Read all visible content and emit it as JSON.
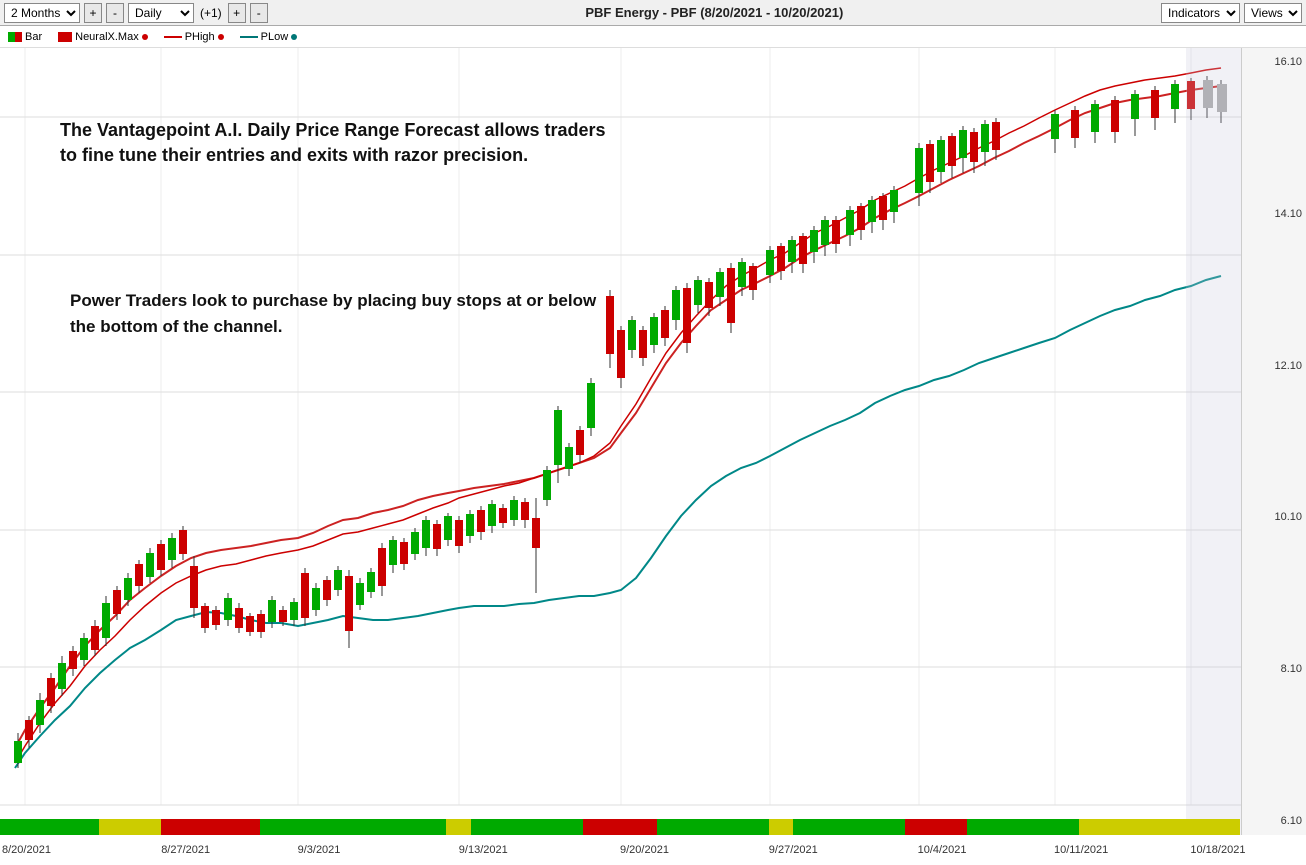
{
  "toolbar": {
    "period": "2 Months",
    "plus_label": "+",
    "minus_label": "-",
    "interval": "Daily",
    "offset_label": "(+1)",
    "plus2_label": "+",
    "minus2_label": "-",
    "title": "PBF Energy - PBF (8/20/2021 - 10/20/2021)",
    "indicators_label": "Indicators",
    "views_label": "Views"
  },
  "legend": {
    "bar_label": "Bar",
    "neural_label": "NeuralX.Max",
    "phigh_label": "PHigh",
    "plow_label": "PLow"
  },
  "annotations": {
    "text1": "The Vantagepoint A.I. Daily Price Range Forecast allows traders to fine tune their entries and exits with razor precision.",
    "text2": "Power Traders look to purchase by placing buy stops at or below the bottom of the channel."
  },
  "prices": {
    "p1": "16.10",
    "p2": "14.10",
    "p3": "12.10",
    "p4": "10.10",
    "p5": "8.10",
    "p6": "6.10"
  },
  "xdates": [
    {
      "label": "8/20/2021",
      "pct": 2
    },
    {
      "label": "8/27/2021",
      "pct": 13
    },
    {
      "label": "9/3/2021",
      "pct": 24
    },
    {
      "label": "9/13/2021",
      "pct": 37
    },
    {
      "label": "9/20/2021",
      "pct": 50
    },
    {
      "label": "9/27/2021",
      "pct": 62
    },
    {
      "label": "10/4/2021",
      "pct": 74
    },
    {
      "label": "10/11/2021",
      "pct": 85
    },
    {
      "label": "10/18/2021",
      "pct": 96
    }
  ]
}
